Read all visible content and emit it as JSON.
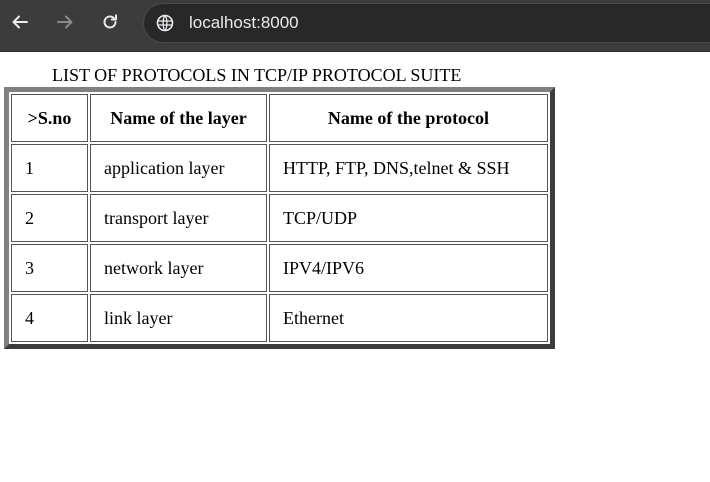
{
  "browser": {
    "url": "localhost:8000",
    "icons": {
      "back": "arrow-left-icon",
      "forward": "arrow-right-icon",
      "reload": "reload-icon",
      "site": "globe-icon"
    }
  },
  "page": {
    "caption": "LIST OF PROTOCOLS IN TCP/IP PROTOCOL SUITE",
    "table": {
      "headers": [
        ">S.no",
        "Name of the layer",
        "Name of the protocol"
      ],
      "rows": [
        [
          "1",
          "application layer",
          "HTTP, FTP, DNS,telnet & SSH"
        ],
        [
          "2",
          "transport layer",
          "TCP/UDP"
        ],
        [
          "3",
          "network layer",
          "IPV4/IPV6"
        ],
        [
          "4",
          "link layer",
          "Ethernet"
        ]
      ]
    }
  }
}
